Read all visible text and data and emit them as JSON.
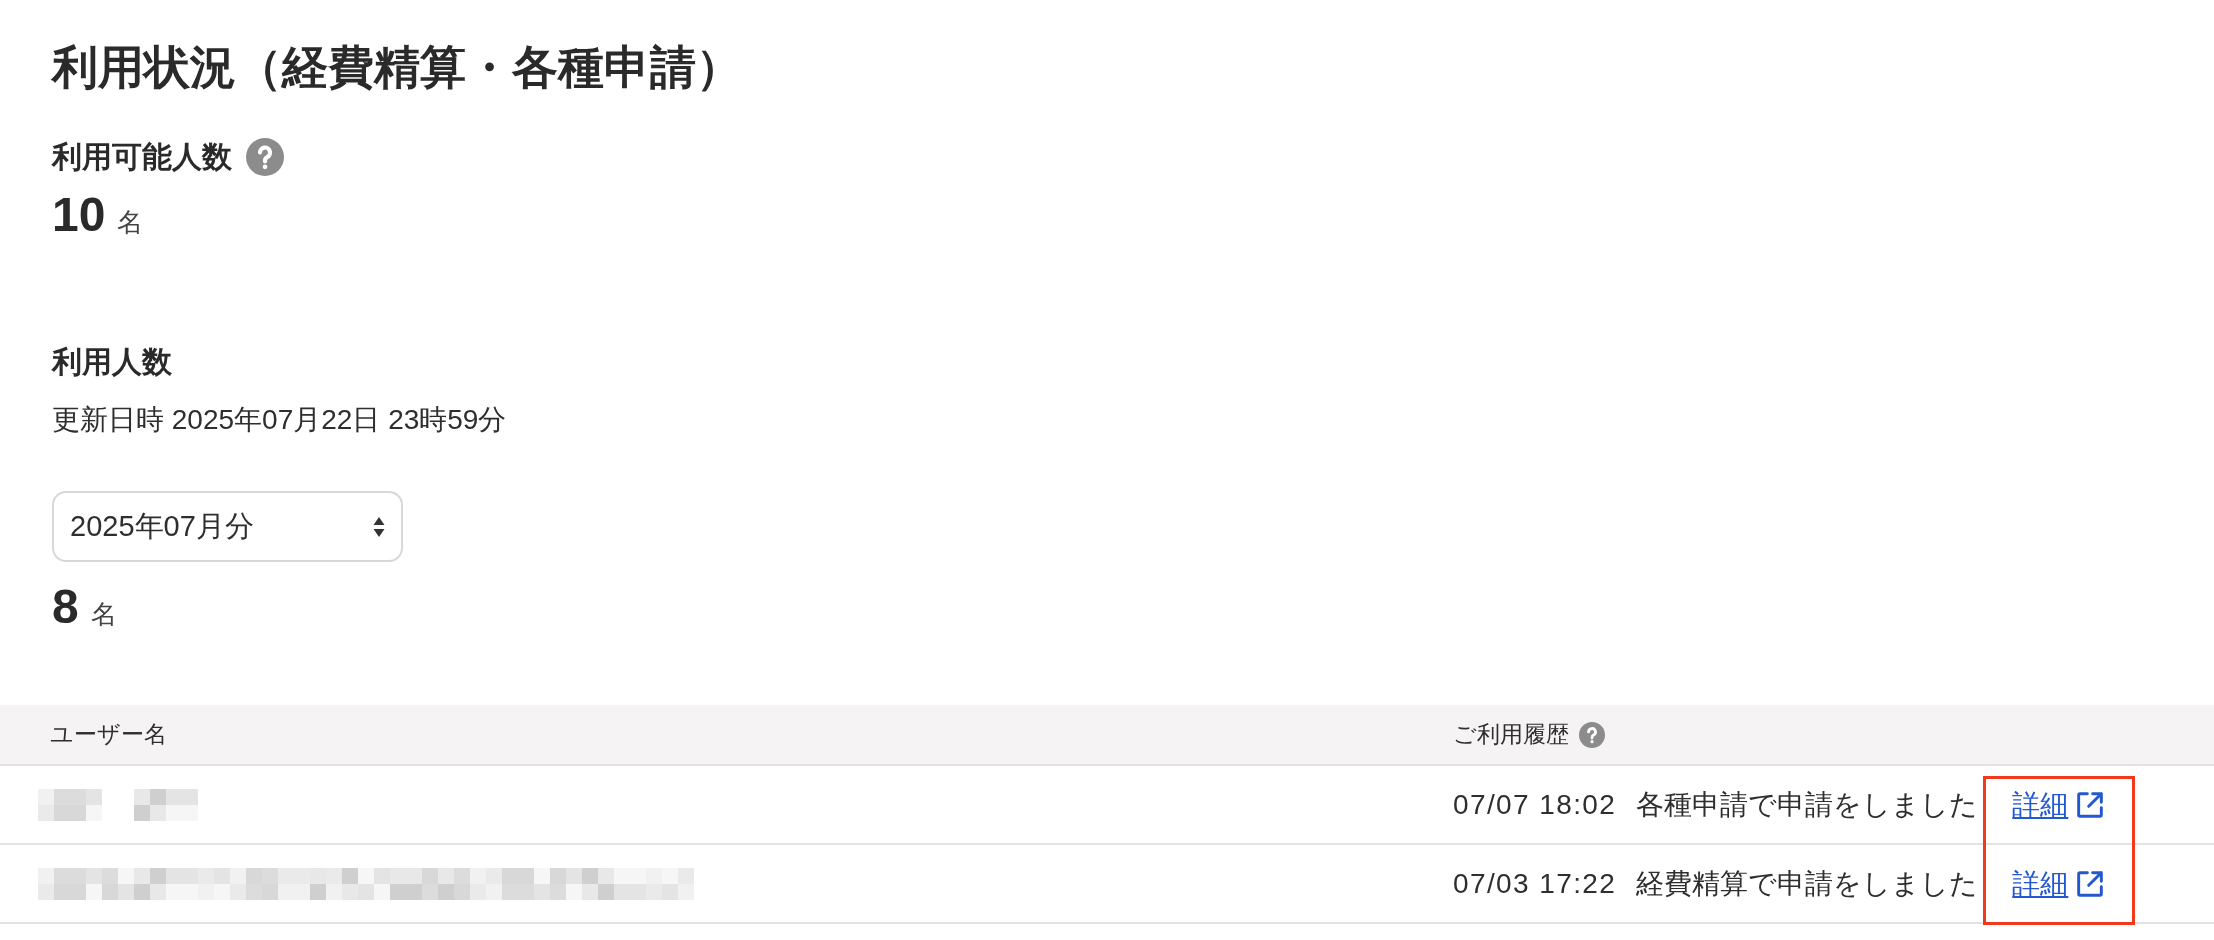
{
  "title": "利用状況（経費精算・各種申請）",
  "available_users": {
    "label": "利用可能人数",
    "help": true,
    "count": "10",
    "unit": "名"
  },
  "usage": {
    "label": "利用人数",
    "updated": "更新日時 2025年07月22日 23時59分",
    "month_select": {
      "value": "2025年07月分"
    },
    "count": "8",
    "unit": "名"
  },
  "table": {
    "columns": [
      {
        "label": "ユーザー名",
        "help": false
      },
      {
        "label": "ご利用履歴",
        "help": true
      }
    ],
    "rows": [
      {
        "user": {
          "kind": "redacted-pair"
        },
        "time": "07/07 18:02",
        "message": "各種申請で申請をしました",
        "link": "詳細"
      },
      {
        "user": {
          "kind": "redacted-long"
        },
        "time": "07/03 17:22",
        "message": "経費精算で申請をしました",
        "link": "詳細"
      }
    ],
    "link_column_highlighted": true
  }
}
